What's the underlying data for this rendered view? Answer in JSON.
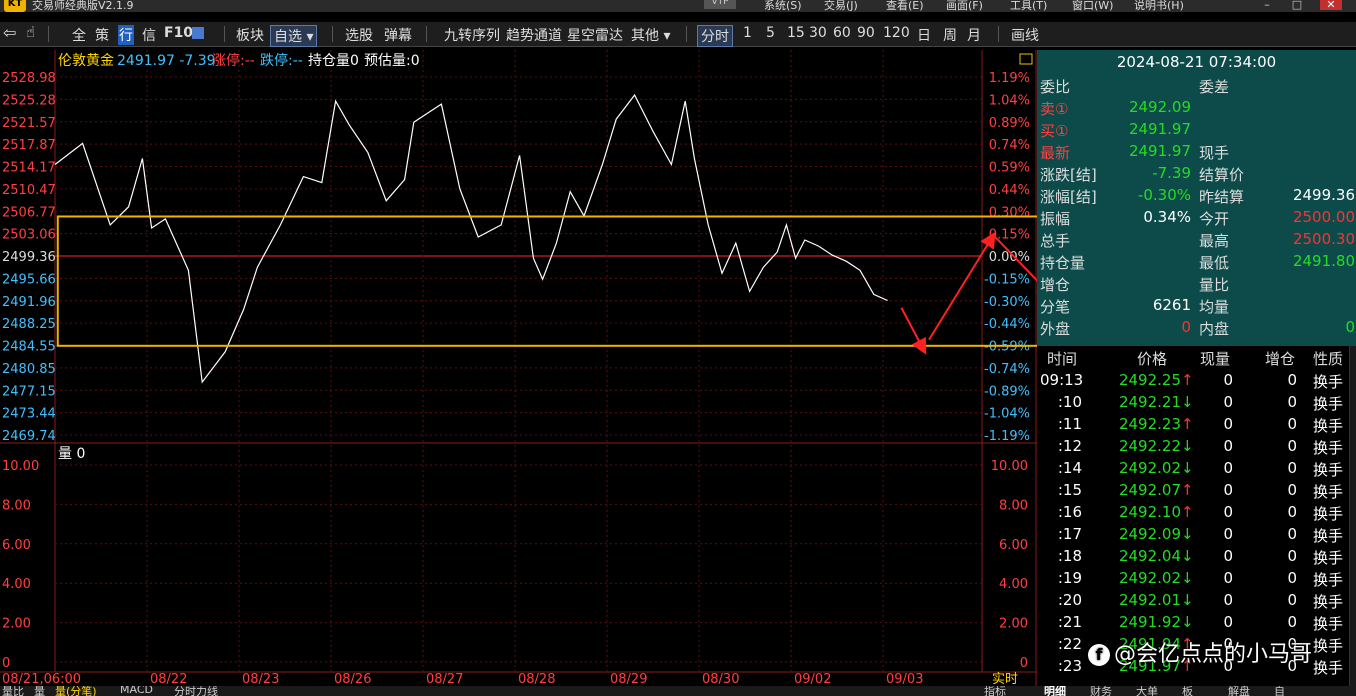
{
  "app": {
    "title": "交易师经典版V2.1.9",
    "logo": "KT",
    "version_badge": "VTP",
    "menus": [
      "系统(S)",
      "交易(J)",
      "查看(E)",
      "画面(F)",
      "工具(T)",
      "窗口(W)",
      "说明书(H)"
    ]
  },
  "toolbar": {
    "items": [
      "全",
      "策",
      "行",
      "信",
      "F10",
      "板块",
      "自选",
      "选股",
      "弹幕",
      "九转序列",
      "趋势通道",
      "星空雷达",
      "其他",
      "分时",
      "1",
      "5",
      "15",
      "30",
      "60",
      "90",
      "120",
      "日",
      "周",
      "月",
      "画线"
    ],
    "selected_watch": "自选",
    "active_period": "分时"
  },
  "header": {
    "instrument": "伦敦黄金",
    "price": "2491.97",
    "change": "-7.39",
    "limit_up": "涨停:--",
    "limit_down": "跌停:--",
    "open_interest": "持仓量0",
    "est_volume": "预估量:0"
  },
  "chart_data": {
    "type": "line",
    "instrument": "伦敦黄金",
    "y_ticks": [
      "2528.98",
      "2525.28",
      "2521.57",
      "2517.87",
      "2514.17",
      "2510.47",
      "2506.77",
      "2503.06",
      "2499.36",
      "2495.66",
      "2491.96",
      "2488.25",
      "2484.55",
      "2480.85",
      "2477.15",
      "2473.44",
      "2469.74"
    ],
    "pct_ticks": [
      "1.19%",
      "1.04%",
      "0.89%",
      "0.74%",
      "0.59%",
      "0.44%",
      "0.30%",
      "0.15%",
      "0.00%",
      "-0.15%",
      "-0.30%",
      "-0.44%",
      "-0.59%",
      "-0.74%",
      "-0.89%",
      "-1.04%",
      "-1.19%"
    ],
    "ylim": [
      2469.74,
      2528.98
    ],
    "base_price": 2499.36,
    "x_ticks": [
      "08/21,06:00",
      "08/22",
      "08/23",
      "08/26",
      "08/27",
      "08/28",
      "08/29",
      "08/30",
      "09/02",
      "09/03"
    ],
    "x": [
      0,
      0.3,
      0.6,
      0.8,
      0.95,
      1.05,
      1.2,
      1.45,
      1.6,
      1.85,
      2.05,
      2.2,
      2.45,
      2.7,
      2.9,
      3.05,
      3.2,
      3.4,
      3.6,
      3.8,
      3.9,
      4.05,
      4.2,
      4.4,
      4.6,
      4.85,
      5.05,
      5.2,
      5.3,
      5.45,
      5.6,
      5.75,
      5.95,
      6.1,
      6.3,
      6.5,
      6.7,
      6.85,
      6.95,
      7.1,
      7.25,
      7.4,
      7.55,
      7.7,
      7.85,
      7.95,
      8.05,
      8.15,
      8.3,
      8.45,
      8.6,
      8.75,
      8.9,
      9.05
    ],
    "y": [
      2514.5,
      2518.0,
      2504.5,
      2507.5,
      2515.5,
      2504.0,
      2505.5,
      2497.0,
      2478.5,
      2483.5,
      2490.5,
      2497.5,
      2504.5,
      2512.5,
      2511.5,
      2525.0,
      2521.0,
      2516.5,
      2508.5,
      2512.0,
      2521.5,
      2523.0,
      2524.5,
      2510.5,
      2502.5,
      2504.5,
      2516.0,
      2499.0,
      2495.5,
      2501.5,
      2510.0,
      2506.0,
      2514.5,
      2522.0,
      2526.0,
      2520.0,
      2514.5,
      2525.0,
      2515.5,
      2504.5,
      2496.5,
      2501.5,
      2493.5,
      2497.5,
      2500.0,
      2504.5,
      2499.0,
      2502.0,
      2501.0,
      2499.5,
      2498.5,
      2497.0,
      2493.0,
      2492.0
    ],
    "volume_ticks": [
      "10.00",
      "8.00",
      "6.00",
      "4.00",
      "2.00",
      "0"
    ],
    "volume_label": "量",
    "volume_value": "0",
    "realtime_label": "实时",
    "annotation": {
      "box": {
        "y_top": 2505.9,
        "y_bottom": 2484.5
      },
      "arrows": [
        {
          "from": [
            9.2,
            2490.8
          ],
          "to": [
            9.45,
            2483.6
          ]
        },
        {
          "from": [
            9.5,
            2485.5
          ],
          "to": [
            10.2,
            2502.8
          ]
        },
        {
          "from": [
            10.2,
            2502.8
          ],
          "to": [
            10.82,
            2493.0
          ]
        }
      ]
    }
  },
  "quote": {
    "datetime": "2024-08-21 07:34:00",
    "rows": [
      {
        "l1": "委比",
        "v1": "",
        "l2": "委差",
        "v2": ""
      },
      {
        "l1": "卖①",
        "v1": "2492.09",
        "l2": "",
        "v2": ""
      },
      {
        "l1": "买①",
        "v1": "2491.97",
        "l2": "",
        "v2": ""
      },
      {
        "l1": "最新",
        "v1": "2491.97",
        "l2": "现手",
        "v2": ""
      },
      {
        "l1": "涨跌[结]",
        "v1": "-7.39",
        "l2": "结算价",
        "v2": ""
      },
      {
        "l1": "涨幅[结]",
        "v1": "-0.30%",
        "l2": "昨结算",
        "v2": "2499.36"
      },
      {
        "l1": "振幅",
        "v1": "0.34%",
        "l2": "今开",
        "v2": "2500.00"
      },
      {
        "l1": "总手",
        "v1": "",
        "l2": "最高",
        "v2": "2500.30"
      },
      {
        "l1": "持仓量",
        "v1": "",
        "l2": "最低",
        "v2": "2491.80"
      },
      {
        "l1": "增仓",
        "v1": "",
        "l2": "量比",
        "v2": ""
      },
      {
        "l1": "分笔",
        "v1": "6261",
        "l2": "均量",
        "v2": ""
      },
      {
        "l1": "外盘",
        "v1": "0",
        "l2": "内盘",
        "v2": "0"
      }
    ],
    "colors": {
      "up": "#ff3030",
      "down": "#22dd22",
      "label_red": "#ff3030",
      "neutral": "#ffffff"
    }
  },
  "ticks": {
    "headers": [
      "时间",
      "价格",
      "现量",
      "增仓",
      "性质"
    ],
    "rows": [
      {
        "time": "09:13",
        "price": "2492.25",
        "dir": "↑",
        "vol": "0",
        "oi": "0",
        "kind": "换手"
      },
      {
        "time": ":10",
        "price": "2492.21",
        "dir": "↓",
        "vol": "0",
        "oi": "0",
        "kind": "换手"
      },
      {
        "time": ":11",
        "price": "2492.23",
        "dir": "↑",
        "vol": "0",
        "oi": "0",
        "kind": "换手"
      },
      {
        "time": ":12",
        "price": "2492.22",
        "dir": "↓",
        "vol": "0",
        "oi": "0",
        "kind": "换手"
      },
      {
        "time": ":14",
        "price": "2492.02",
        "dir": "↓",
        "vol": "0",
        "oi": "0",
        "kind": "换手"
      },
      {
        "time": ":15",
        "price": "2492.07",
        "dir": "↑",
        "vol": "0",
        "oi": "0",
        "kind": "换手"
      },
      {
        "time": ":16",
        "price": "2492.10",
        "dir": "↑",
        "vol": "0",
        "oi": "0",
        "kind": "换手"
      },
      {
        "time": ":17",
        "price": "2492.09",
        "dir": "↓",
        "vol": "0",
        "oi": "0",
        "kind": "换手"
      },
      {
        "time": ":18",
        "price": "2492.04",
        "dir": "↓",
        "vol": "0",
        "oi": "0",
        "kind": "换手"
      },
      {
        "time": ":19",
        "price": "2492.02",
        "dir": "↓",
        "vol": "0",
        "oi": "0",
        "kind": "换手"
      },
      {
        "time": ":20",
        "price": "2492.01",
        "dir": "↓",
        "vol": "0",
        "oi": "0",
        "kind": "换手"
      },
      {
        "time": ":21",
        "price": "2491.92",
        "dir": "↓",
        "vol": "0",
        "oi": "0",
        "kind": "换手"
      },
      {
        "time": ":22",
        "price": "2491.94",
        "dir": "↑",
        "vol": "0",
        "oi": "0",
        "kind": "换手"
      },
      {
        "time": ":23",
        "price": "2491.97",
        "dir": "↑",
        "vol": "0",
        "oi": "0",
        "kind": "换手"
      }
    ]
  },
  "bottom": {
    "left_tabs": [
      "量比",
      "量",
      "量(分笔)",
      "MACD",
      "分时力线"
    ],
    "right_tabs": [
      "明细",
      "财务",
      "大单",
      "板",
      "解盘",
      "自"
    ],
    "right_label": "指标"
  },
  "watermark": "@会亿点点的小马哥"
}
